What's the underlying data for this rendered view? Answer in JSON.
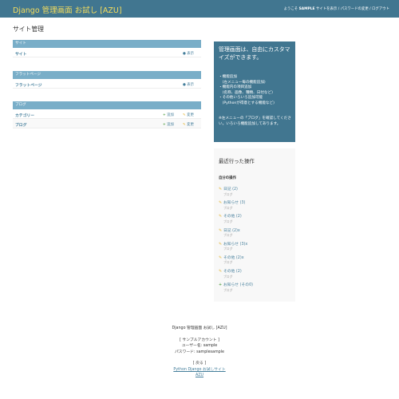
{
  "header": {
    "brand": "Django 管理画面 お試し [AZU]",
    "welcome": "ようこそ",
    "username": "SAMPLE",
    "view_site": "サイトを表示",
    "change_password": "パスワードの変更",
    "logout": "ログアウト",
    "separator": "/"
  },
  "page_title": "サイト管理",
  "modules": [
    {
      "caption": "サイト",
      "rows": [
        {
          "name": "サイト",
          "view": "表示"
        }
      ]
    },
    {
      "caption": "フラットページ",
      "rows": [
        {
          "name": "フラットページ",
          "view": "表示"
        }
      ]
    },
    {
      "caption": "ブログ",
      "rows": [
        {
          "name": "カテゴリー",
          "add": "追加",
          "change": "変更"
        },
        {
          "name": "ブログ",
          "add": "追加",
          "change": "変更"
        }
      ]
    }
  ],
  "info_box": {
    "title": "管理画面は、自由にカスタマイズができます。",
    "items": [
      "・機能追加",
      "　(左メニュー毎の機能追加)",
      "・機能内の項目追加",
      "　(名称、画像、種類、日付など)",
      "・その他いろいろ追加可能",
      "　(Pythonが得意とする機能など)"
    ],
    "note": "※左メニューの「ブログ」を確認してください。いろいろ機能追加してあります。"
  },
  "recent_actions": {
    "title": "最近行った操作",
    "subtitle": "自分の操作",
    "entries": [
      {
        "icon": "change",
        "label": "日記 (2)",
        "type": "ブログ"
      },
      {
        "icon": "change",
        "label": "お知らせ (3)",
        "type": "ブログ"
      },
      {
        "icon": "change",
        "label": "その他 (2)",
        "type": "ブログ"
      },
      {
        "icon": "change",
        "label": "日記 (2)x",
        "type": "ブログ"
      },
      {
        "icon": "change",
        "label": "お知らせ (3)x",
        "type": "ブログ"
      },
      {
        "icon": "change",
        "label": "その他 (2)x",
        "type": "ブログ"
      },
      {
        "icon": "change",
        "label": "その他 (2)",
        "type": "ブログ"
      },
      {
        "icon": "add",
        "label": "お知らせ (その0)",
        "type": "ブログ"
      }
    ]
  },
  "footer": {
    "line1": "Django 管理画面 お試し [AZU]",
    "line2": "[ サンプルアカウント ]",
    "line3": "ユーザー名: sample",
    "line4": "パスワード: samplesample",
    "line5": "[ 戻る ]",
    "link1": "Python Django お試しサイト",
    "link2": "AZU"
  },
  "icons": {
    "view": "eye-icon",
    "add": "plus-icon",
    "change": "pencil-icon"
  },
  "colors": {
    "header_bg": "#417690",
    "brand": "#f5dd5d",
    "caption_bg": "#79aec8",
    "link": "#447e9b",
    "add_green": "#5aa34a",
    "change_yellow": "#e2b128"
  }
}
